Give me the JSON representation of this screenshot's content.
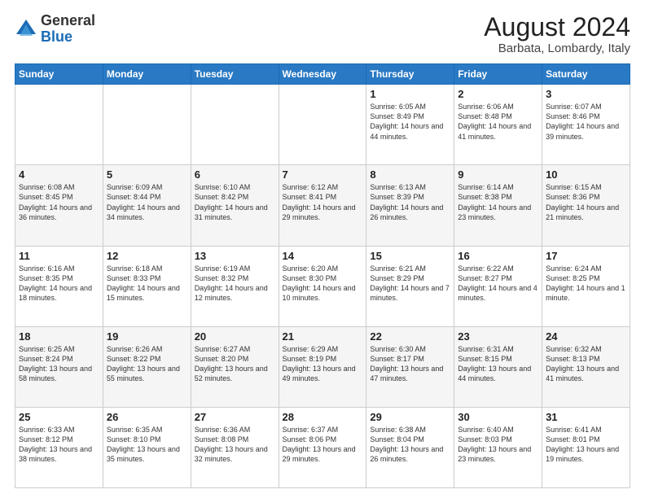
{
  "logo": {
    "general": "General",
    "blue": "Blue"
  },
  "header": {
    "month": "August 2024",
    "location": "Barbata, Lombardy, Italy"
  },
  "weekdays": [
    "Sunday",
    "Monday",
    "Tuesday",
    "Wednesday",
    "Thursday",
    "Friday",
    "Saturday"
  ],
  "weeks": [
    [
      {
        "day": "",
        "info": ""
      },
      {
        "day": "",
        "info": ""
      },
      {
        "day": "",
        "info": ""
      },
      {
        "day": "",
        "info": ""
      },
      {
        "day": "1",
        "info": "Sunrise: 6:05 AM\nSunset: 8:49 PM\nDaylight: 14 hours\nand 44 minutes."
      },
      {
        "day": "2",
        "info": "Sunrise: 6:06 AM\nSunset: 8:48 PM\nDaylight: 14 hours\nand 41 minutes."
      },
      {
        "day": "3",
        "info": "Sunrise: 6:07 AM\nSunset: 8:46 PM\nDaylight: 14 hours\nand 39 minutes."
      }
    ],
    [
      {
        "day": "4",
        "info": "Sunrise: 6:08 AM\nSunset: 8:45 PM\nDaylight: 14 hours\nand 36 minutes."
      },
      {
        "day": "5",
        "info": "Sunrise: 6:09 AM\nSunset: 8:44 PM\nDaylight: 14 hours\nand 34 minutes."
      },
      {
        "day": "6",
        "info": "Sunrise: 6:10 AM\nSunset: 8:42 PM\nDaylight: 14 hours\nand 31 minutes."
      },
      {
        "day": "7",
        "info": "Sunrise: 6:12 AM\nSunset: 8:41 PM\nDaylight: 14 hours\nand 29 minutes."
      },
      {
        "day": "8",
        "info": "Sunrise: 6:13 AM\nSunset: 8:39 PM\nDaylight: 14 hours\nand 26 minutes."
      },
      {
        "day": "9",
        "info": "Sunrise: 6:14 AM\nSunset: 8:38 PM\nDaylight: 14 hours\nand 23 minutes."
      },
      {
        "day": "10",
        "info": "Sunrise: 6:15 AM\nSunset: 8:36 PM\nDaylight: 14 hours\nand 21 minutes."
      }
    ],
    [
      {
        "day": "11",
        "info": "Sunrise: 6:16 AM\nSunset: 8:35 PM\nDaylight: 14 hours\nand 18 minutes."
      },
      {
        "day": "12",
        "info": "Sunrise: 6:18 AM\nSunset: 8:33 PM\nDaylight: 14 hours\nand 15 minutes."
      },
      {
        "day": "13",
        "info": "Sunrise: 6:19 AM\nSunset: 8:32 PM\nDaylight: 14 hours\nand 12 minutes."
      },
      {
        "day": "14",
        "info": "Sunrise: 6:20 AM\nSunset: 8:30 PM\nDaylight: 14 hours\nand 10 minutes."
      },
      {
        "day": "15",
        "info": "Sunrise: 6:21 AM\nSunset: 8:29 PM\nDaylight: 14 hours\nand 7 minutes."
      },
      {
        "day": "16",
        "info": "Sunrise: 6:22 AM\nSunset: 8:27 PM\nDaylight: 14 hours\nand 4 minutes."
      },
      {
        "day": "17",
        "info": "Sunrise: 6:24 AM\nSunset: 8:25 PM\nDaylight: 14 hours\nand 1 minute."
      }
    ],
    [
      {
        "day": "18",
        "info": "Sunrise: 6:25 AM\nSunset: 8:24 PM\nDaylight: 13 hours\nand 58 minutes."
      },
      {
        "day": "19",
        "info": "Sunrise: 6:26 AM\nSunset: 8:22 PM\nDaylight: 13 hours\nand 55 minutes."
      },
      {
        "day": "20",
        "info": "Sunrise: 6:27 AM\nSunset: 8:20 PM\nDaylight: 13 hours\nand 52 minutes."
      },
      {
        "day": "21",
        "info": "Sunrise: 6:29 AM\nSunset: 8:19 PM\nDaylight: 13 hours\nand 49 minutes."
      },
      {
        "day": "22",
        "info": "Sunrise: 6:30 AM\nSunset: 8:17 PM\nDaylight: 13 hours\nand 47 minutes."
      },
      {
        "day": "23",
        "info": "Sunrise: 6:31 AM\nSunset: 8:15 PM\nDaylight: 13 hours\nand 44 minutes."
      },
      {
        "day": "24",
        "info": "Sunrise: 6:32 AM\nSunset: 8:13 PM\nDaylight: 13 hours\nand 41 minutes."
      }
    ],
    [
      {
        "day": "25",
        "info": "Sunrise: 6:33 AM\nSunset: 8:12 PM\nDaylight: 13 hours\nand 38 minutes."
      },
      {
        "day": "26",
        "info": "Sunrise: 6:35 AM\nSunset: 8:10 PM\nDaylight: 13 hours\nand 35 minutes."
      },
      {
        "day": "27",
        "info": "Sunrise: 6:36 AM\nSunset: 8:08 PM\nDaylight: 13 hours\nand 32 minutes."
      },
      {
        "day": "28",
        "info": "Sunrise: 6:37 AM\nSunset: 8:06 PM\nDaylight: 13 hours\nand 29 minutes."
      },
      {
        "day": "29",
        "info": "Sunrise: 6:38 AM\nSunset: 8:04 PM\nDaylight: 13 hours\nand 26 minutes."
      },
      {
        "day": "30",
        "info": "Sunrise: 6:40 AM\nSunset: 8:03 PM\nDaylight: 13 hours\nand 23 minutes."
      },
      {
        "day": "31",
        "info": "Sunrise: 6:41 AM\nSunset: 8:01 PM\nDaylight: 13 hours\nand 19 minutes."
      }
    ]
  ]
}
